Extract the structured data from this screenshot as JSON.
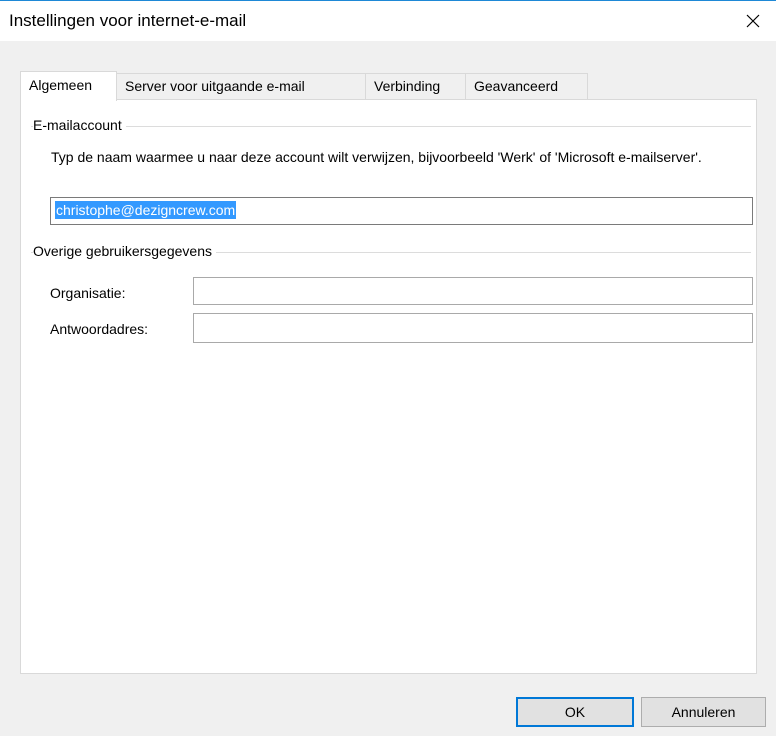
{
  "window": {
    "title": "Instellingen voor internet-e-mail",
    "close_icon": "close-icon",
    "accent": "#0078d7"
  },
  "tabs": [
    {
      "label": "Algemeen",
      "active": true
    },
    {
      "label": "Server voor uitgaande e-mail",
      "active": false
    },
    {
      "label": "Verbinding",
      "active": false
    },
    {
      "label": "Geavanceerd",
      "active": false
    }
  ],
  "email_account": {
    "group_label": "E-mailaccount",
    "description": "Typ de naam waarmee u naar deze account wilt verwijzen, bijvoorbeeld 'Werk' of 'Microsoft e-mailserver'.",
    "account_name": "christophe@dezigncrew.com"
  },
  "other_info": {
    "group_label": "Overige gebruikersgegevens",
    "organization_label": "Organisatie:",
    "organization_value": "",
    "reply_label": "Antwoordadres:",
    "reply_value": ""
  },
  "buttons": {
    "ok": "OK",
    "cancel": "Annuleren"
  }
}
